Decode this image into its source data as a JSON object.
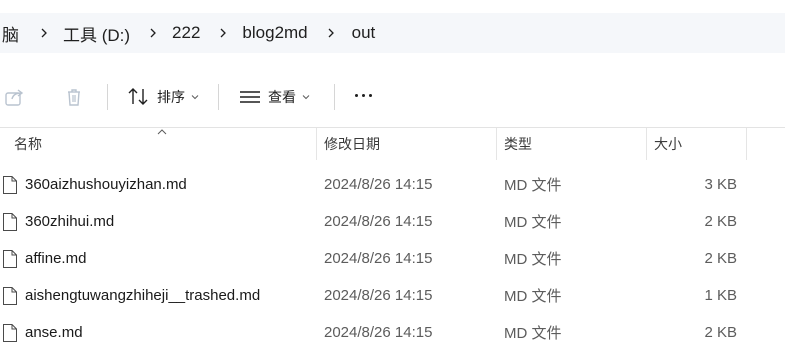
{
  "breadcrumb": {
    "items": [
      "脑",
      "工具 (D:)",
      "222",
      "blog2md",
      "out"
    ]
  },
  "toolbar": {
    "share_icon": "share-icon",
    "delete_icon": "trash-icon",
    "sort_label": "排序",
    "view_label": "查看",
    "more_icon": "more-icon"
  },
  "columns": {
    "name": "名称",
    "date": "修改日期",
    "type": "类型",
    "size": "大小"
  },
  "files": [
    {
      "name": "360aizhushouyizhan.md",
      "date": "2024/8/26 14:15",
      "type": "MD 文件",
      "size": "3 KB"
    },
    {
      "name": "360zhihui.md",
      "date": "2024/8/26 14:15",
      "type": "MD 文件",
      "size": "2 KB"
    },
    {
      "name": "affine.md",
      "date": "2024/8/26 14:15",
      "type": "MD 文件",
      "size": "2 KB"
    },
    {
      "name": "aishengtuwangzhiheji__trashed.md",
      "date": "2024/8/26 14:15",
      "type": "MD 文件",
      "size": "1 KB"
    },
    {
      "name": "anse.md",
      "date": "2024/8/26 14:15",
      "type": "MD 文件",
      "size": "2 KB"
    }
  ],
  "colors": {
    "address_bg": "#f5f7fa",
    "text_primary": "#1a1a1a",
    "text_secondary": "#5c5c5c"
  }
}
